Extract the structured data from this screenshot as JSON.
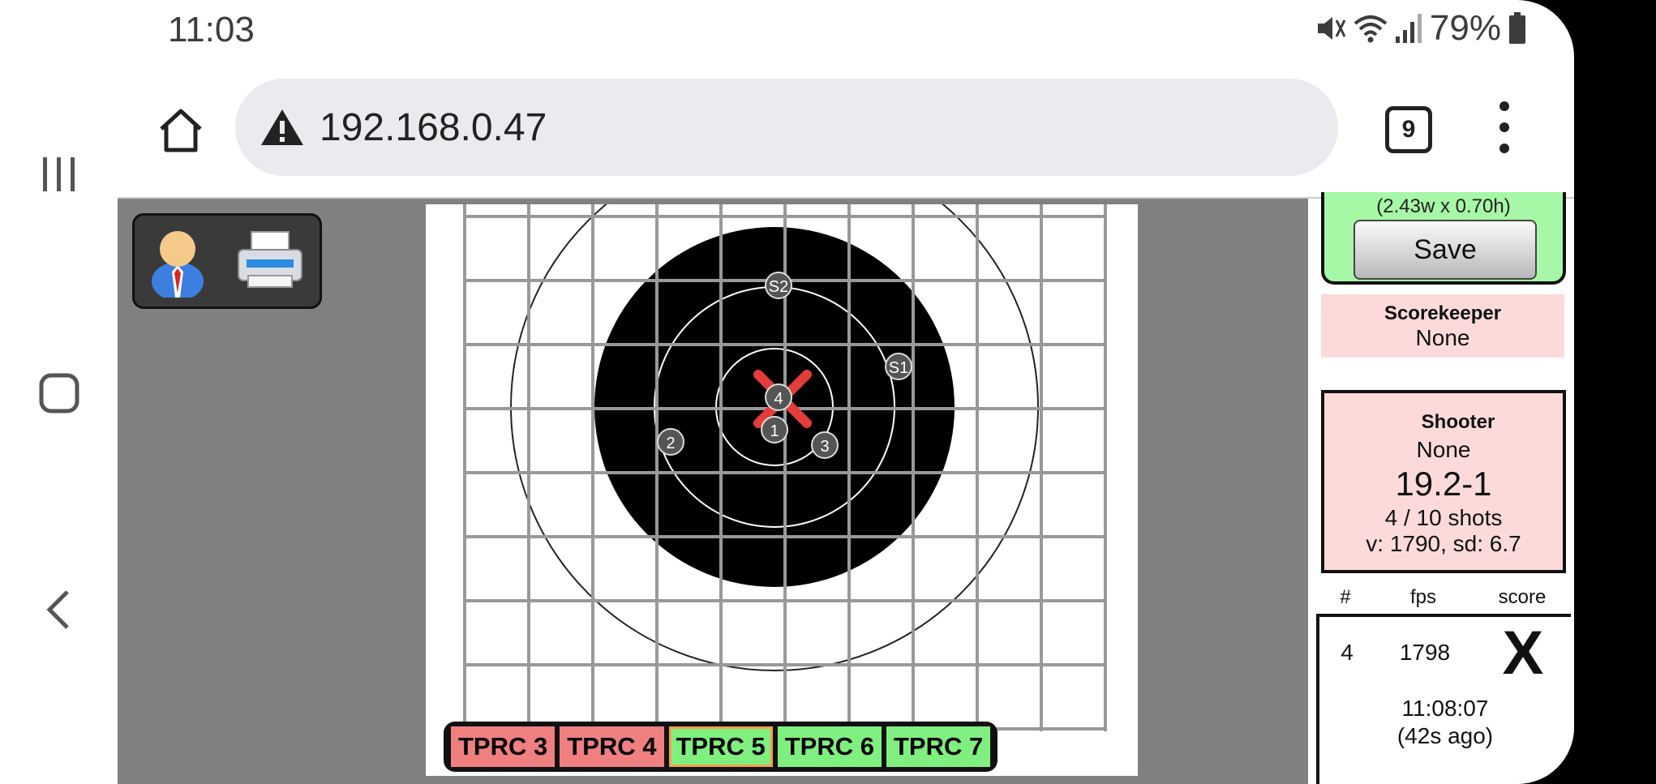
{
  "status_bar": {
    "time": "11:03",
    "battery": "79%"
  },
  "browser": {
    "url": "192.168.0.47",
    "tab_count": "9"
  },
  "target": {
    "shots": [
      {
        "label": "S2"
      },
      {
        "label": "S1"
      },
      {
        "label": "4"
      },
      {
        "label": "1"
      },
      {
        "label": "2"
      },
      {
        "label": "3"
      }
    ]
  },
  "sheet_tabs": [
    {
      "label": "TPRC 3",
      "color": "#f08080",
      "active": false
    },
    {
      "label": "TPRC 4",
      "color": "#f08080",
      "active": false
    },
    {
      "label": "TPRC 5",
      "color": "#7ff07f",
      "active": true
    },
    {
      "label": "TPRC 6",
      "color": "#7ff07f",
      "active": false
    },
    {
      "label": "TPRC 7",
      "color": "#7ff07f",
      "active": false
    }
  ],
  "panel": {
    "dims": "(2.43w x 0.70h)",
    "save_label": "Save",
    "scorekeeper_title": "Scorekeeper",
    "scorekeeper_name": "None",
    "shooter_title": "Shooter",
    "shooter_name": "None",
    "score": "19.2-1",
    "shots_count": "4 / 10 shots",
    "velocity": "v: 1790, sd: 6.7",
    "table_headers": [
      "#",
      "fps",
      "score"
    ],
    "last_shot": {
      "num": "4",
      "fps": "1798",
      "score": "X",
      "time": "11:08:07",
      "ago": "(42s ago)"
    }
  },
  "colors": {
    "green_box": "#a6f7a6",
    "pink_box": "#fcdada",
    "content_bg": "#808080",
    "shot_marker": "#e43b3b"
  }
}
